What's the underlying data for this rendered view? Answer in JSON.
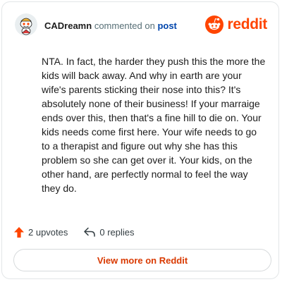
{
  "header": {
    "username": "CADreamn",
    "verb": "commented on",
    "post_link": "post",
    "brand": "reddit",
    "avatar_icon": "snoo-avatar-icon",
    "brand_icon": "reddit-logo-icon"
  },
  "comment": {
    "text": "NTA. In fact, the harder they push this the more the kids will back away. And why in earth are your wife's parents sticking their nose into this? It's absolutely none of their business! If your marraige ends over this, then that's a fine hill to die on. Your kids needs come first here. Your wife needs to go to a therapist and figure out why she has this problem so she can get over it. Your kids, on the other hand, are perfectly normal to feel the way they do."
  },
  "actions": {
    "upvotes_label": "2 upvotes",
    "upvote_icon": "upvote-arrow-icon",
    "replies_label": "0 replies",
    "reply_icon": "reply-arrow-icon"
  },
  "footer": {
    "view_more_label": "View more on Reddit"
  },
  "colors": {
    "brand": "#ff4500",
    "link": "#0045ac",
    "cta_text": "#d93900",
    "muted": "#576f76"
  }
}
